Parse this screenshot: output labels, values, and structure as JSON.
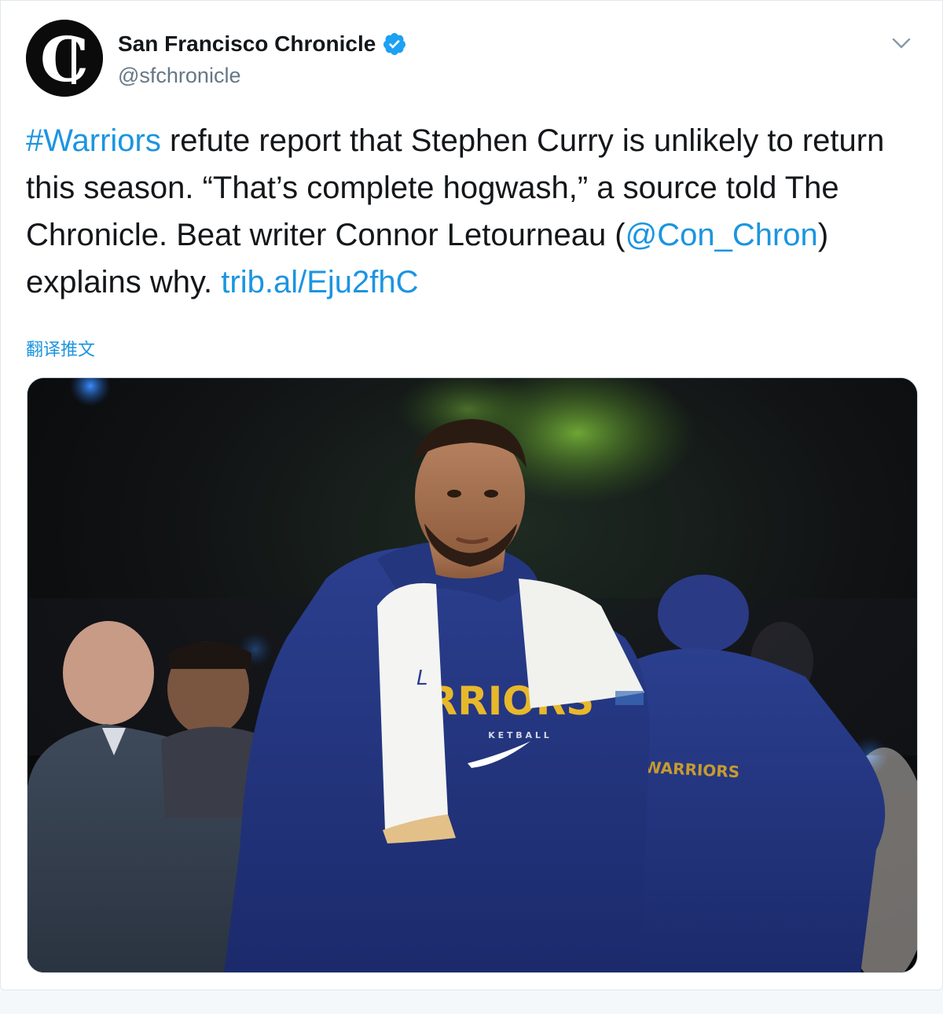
{
  "author": {
    "display_name": "San Francisco Chronicle",
    "handle": "@sfchronicle",
    "verified": true,
    "avatar_letter": "C",
    "avatar_bg": "#0b0b0b"
  },
  "tweet": {
    "hashtag": "#Warriors",
    "text_part1": " refute report that Stephen Curry is unlikely to return this season. “That’s complete hogwash,” a source told The Chronicle. Beat writer Connor Letourneau (",
    "mention": "@Con_Chron",
    "text_part2": ") explains why. ",
    "link": "trib.al/Eju2fhC"
  },
  "translate_label": "翻译推文",
  "media": {
    "type": "photo",
    "jersey_text": "RRIORS",
    "jersey_subtext": "K E T B A L L",
    "towel_letter": "L",
    "background_jersey_text": "WARRIORS"
  },
  "colors": {
    "link": "#1b95e0",
    "text": "#14171a",
    "secondary": "#657786",
    "verified": "#1da1f2",
    "border": "#e1e8ed"
  },
  "icons": {
    "verified": "verified-badge-icon",
    "menu": "chevron-down-icon"
  }
}
